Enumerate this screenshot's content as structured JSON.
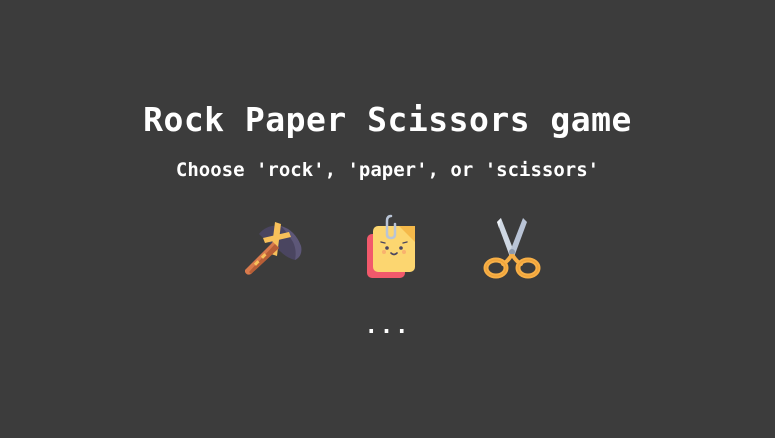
{
  "title": "Rock Paper Scissors game",
  "subtitle": "Choose 'rock', 'paper', or 'scissors'",
  "choices": [
    {
      "id": "rock",
      "icon": "rock-hammer-icon"
    },
    {
      "id": "paper",
      "icon": "paper-note-icon"
    },
    {
      "id": "scissors",
      "icon": "scissors-icon"
    }
  ],
  "result_text": "...",
  "colors": {
    "background": "#3c3c3c",
    "text": "#ffffff",
    "rock": "#4a4560",
    "wood": "#d97a4c",
    "paper_yellow": "#fcd670",
    "paper_red": "#f2596b",
    "scissors_handle": "#f8b047",
    "scissors_blade": "#cfd8e3"
  }
}
